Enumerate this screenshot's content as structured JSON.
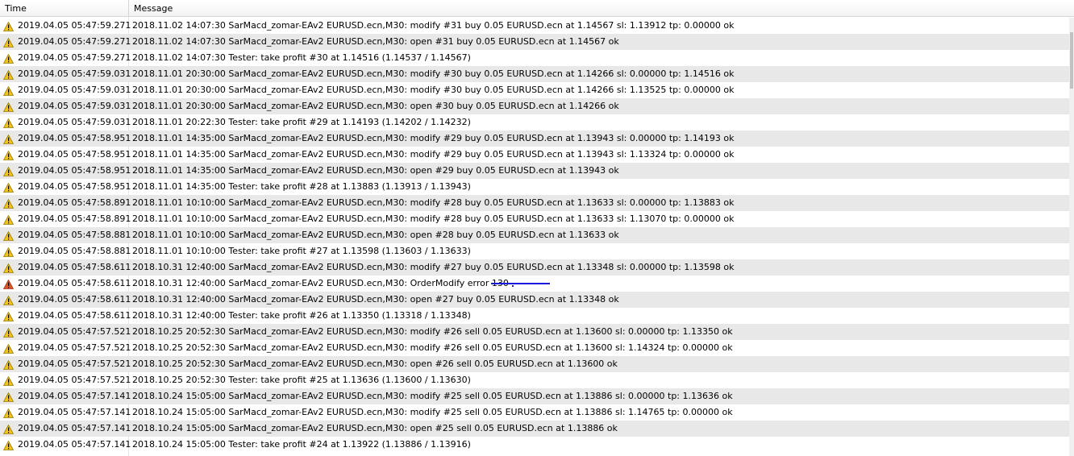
{
  "columns": {
    "time": "Time",
    "message": "Message"
  },
  "colors": {
    "warning_icon": "#f3c319",
    "error_icon": "#e0542a",
    "alt_row": "#e8e8e8",
    "annotation": "#1a1adc"
  },
  "rows": [
    {
      "icon": "warning-icon",
      "time": "2019.04.05 05:47:59.271",
      "message": "2018.11.02 14:07:30   SarMacd_zomar-EAv2 EURUSD.ecn,M30: modify #31 buy 0.05 EURUSD.ecn at 1.14567 sl: 1.13912 tp: 0.00000 ok"
    },
    {
      "icon": "warning-icon",
      "time": "2019.04.05 05:47:59.271",
      "message": "2018.11.02 14:07:30   SarMacd_zomar-EAv2 EURUSD.ecn,M30: open #31 buy 0.05 EURUSD.ecn at 1.14567 ok"
    },
    {
      "icon": "warning-icon",
      "time": "2019.04.05 05:47:59.271",
      "message": "2018.11.02 14:07:30   Tester: take profit #30 at 1.14516 (1.14537 / 1.14567)"
    },
    {
      "icon": "warning-icon",
      "time": "2019.04.05 05:47:59.031",
      "message": "2018.11.01 20:30:00   SarMacd_zomar-EAv2 EURUSD.ecn,M30: modify #30 buy 0.05 EURUSD.ecn at 1.14266 sl: 0.00000 tp: 1.14516 ok"
    },
    {
      "icon": "warning-icon",
      "time": "2019.04.05 05:47:59.031",
      "message": "2018.11.01 20:30:00   SarMacd_zomar-EAv2 EURUSD.ecn,M30: modify #30 buy 0.05 EURUSD.ecn at 1.14266 sl: 1.13525 tp: 0.00000 ok"
    },
    {
      "icon": "warning-icon",
      "time": "2019.04.05 05:47:59.031",
      "message": "2018.11.01 20:30:00   SarMacd_zomar-EAv2 EURUSD.ecn,M30: open #30 buy 0.05 EURUSD.ecn at 1.14266 ok"
    },
    {
      "icon": "warning-icon",
      "time": "2019.04.05 05:47:59.031",
      "message": "2018.11.01 20:22:30   Tester: take profit #29 at 1.14193 (1.14202 / 1.14232)"
    },
    {
      "icon": "warning-icon",
      "time": "2019.04.05 05:47:58.951",
      "message": "2018.11.01 14:35:00   SarMacd_zomar-EAv2 EURUSD.ecn,M30: modify #29 buy 0.05 EURUSD.ecn at 1.13943 sl: 0.00000 tp: 1.14193 ok"
    },
    {
      "icon": "warning-icon",
      "time": "2019.04.05 05:47:58.951",
      "message": "2018.11.01 14:35:00   SarMacd_zomar-EAv2 EURUSD.ecn,M30: modify #29 buy 0.05 EURUSD.ecn at 1.13943 sl: 1.13324 tp: 0.00000 ok"
    },
    {
      "icon": "warning-icon",
      "time": "2019.04.05 05:47:58.951",
      "message": "2018.11.01 14:35:00   SarMacd_zomar-EAv2 EURUSD.ecn,M30: open #29 buy 0.05 EURUSD.ecn at 1.13943 ok"
    },
    {
      "icon": "warning-icon",
      "time": "2019.04.05 05:47:58.951",
      "message": "2018.11.01 14:35:00   Tester: take profit #28 at 1.13883 (1.13913 / 1.13943)"
    },
    {
      "icon": "warning-icon",
      "time": "2019.04.05 05:47:58.891",
      "message": "2018.11.01 10:10:00   SarMacd_zomar-EAv2 EURUSD.ecn,M30: modify #28 buy 0.05 EURUSD.ecn at 1.13633 sl: 0.00000 tp: 1.13883 ok"
    },
    {
      "icon": "warning-icon",
      "time": "2019.04.05 05:47:58.891",
      "message": "2018.11.01 10:10:00   SarMacd_zomar-EAv2 EURUSD.ecn,M30: modify #28 buy 0.05 EURUSD.ecn at 1.13633 sl: 1.13070 tp: 0.00000 ok"
    },
    {
      "icon": "warning-icon",
      "time": "2019.04.05 05:47:58.881",
      "message": "2018.11.01 10:10:00   SarMacd_zomar-EAv2 EURUSD.ecn,M30: open #28 buy 0.05 EURUSD.ecn at 1.13633 ok"
    },
    {
      "icon": "warning-icon",
      "time": "2019.04.05 05:47:58.881",
      "message": "2018.11.01 10:10:00   Tester: take profit #27 at 1.13598 (1.13603 / 1.13633)"
    },
    {
      "icon": "warning-icon",
      "time": "2019.04.05 05:47:58.611",
      "message": "2018.10.31 12:40:00   SarMacd_zomar-EAv2 EURUSD.ecn,M30: modify #27 buy 0.05 EURUSD.ecn at 1.13348 sl: 0.00000 tp: 1.13598 ok"
    },
    {
      "icon": "error-icon",
      "time": "2019.04.05 05:47:58.611",
      "message": "2018.10.31 12:40:00   SarMacd_zomar-EAv2 EURUSD.ecn,M30: OrderModify error 130"
    },
    {
      "icon": "warning-icon",
      "time": "2019.04.05 05:47:58.611",
      "message": "2018.10.31 12:40:00   SarMacd_zomar-EAv2 EURUSD.ecn,M30: open #27 buy 0.05 EURUSD.ecn at 1.13348 ok"
    },
    {
      "icon": "warning-icon",
      "time": "2019.04.05 05:47:58.611",
      "message": "2018.10.31 12:40:00   Tester: take profit #26 at 1.13350 (1.13318 / 1.13348)"
    },
    {
      "icon": "warning-icon",
      "time": "2019.04.05 05:47:57.521",
      "message": "2018.10.25 20:52:30   SarMacd_zomar-EAv2 EURUSD.ecn,M30: modify #26 sell 0.05 EURUSD.ecn at 1.13600 sl: 0.00000 tp: 1.13350 ok"
    },
    {
      "icon": "warning-icon",
      "time": "2019.04.05 05:47:57.521",
      "message": "2018.10.25 20:52:30   SarMacd_zomar-EAv2 EURUSD.ecn,M30: modify #26 sell 0.05 EURUSD.ecn at 1.13600 sl: 1.14324 tp: 0.00000 ok"
    },
    {
      "icon": "warning-icon",
      "time": "2019.04.05 05:47:57.521",
      "message": "2018.10.25 20:52:30   SarMacd_zomar-EAv2 EURUSD.ecn,M30: open #26 sell 0.05 EURUSD.ecn at 1.13600 ok"
    },
    {
      "icon": "warning-icon",
      "time": "2019.04.05 05:47:57.521",
      "message": "2018.10.25 20:52:30   Tester: take profit #25 at 1.13636 (1.13600 / 1.13630)"
    },
    {
      "icon": "warning-icon",
      "time": "2019.04.05 05:47:57.141",
      "message": "2018.10.24 15:05:00   SarMacd_zomar-EAv2 EURUSD.ecn,M30: modify #25 sell 0.05 EURUSD.ecn at 1.13886 sl: 0.00000 tp: 1.13636 ok"
    },
    {
      "icon": "warning-icon",
      "time": "2019.04.05 05:47:57.141",
      "message": "2018.10.24 15:05:00   SarMacd_zomar-EAv2 EURUSD.ecn,M30: modify #25 sell 0.05 EURUSD.ecn at 1.13886 sl: 1.14765 tp: 0.00000 ok"
    },
    {
      "icon": "warning-icon",
      "time": "2019.04.05 05:47:57.141",
      "message": "2018.10.24 15:05:00   SarMacd_zomar-EAv2 EURUSD.ecn,M30: open #25 sell 0.05 EURUSD.ecn at 1.13886 ok"
    },
    {
      "icon": "warning-icon",
      "time": "2019.04.05 05:47:57.141",
      "message": "2018.10.24 15:05:00   Tester: take profit #24 at 1.13922 (1.13886 / 1.13916)"
    }
  ]
}
